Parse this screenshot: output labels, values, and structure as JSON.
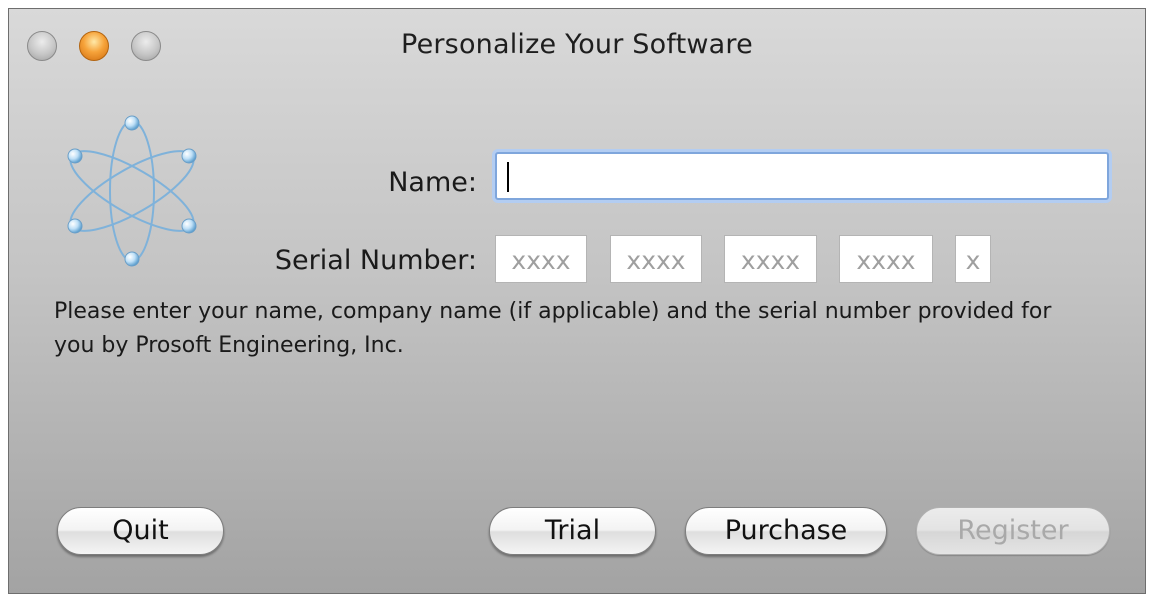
{
  "window": {
    "title": "Personalize Your Software"
  },
  "form": {
    "name_label": "Name:",
    "name_value": "",
    "serial_label": "Serial Number:",
    "serial_placeholders": [
      "xxxx",
      "xxxx",
      "xxxx",
      "xxxx",
      "x"
    ]
  },
  "instructions": "Please enter your name, company name (if applicable) and the serial number provided for you by Prosoft Engineering, Inc.",
  "buttons": {
    "quit": "Quit",
    "trial": "Trial",
    "purchase": "Purchase",
    "register": "Register"
  },
  "icons": {
    "app_logo": "atom-icon",
    "close": "close-button",
    "minimize": "minimize-button",
    "zoom": "zoom-button"
  },
  "colors": {
    "focus_ring": "#b3cdf2",
    "minimize_button": "#f6a33a"
  },
  "state": {
    "register_enabled": false
  }
}
